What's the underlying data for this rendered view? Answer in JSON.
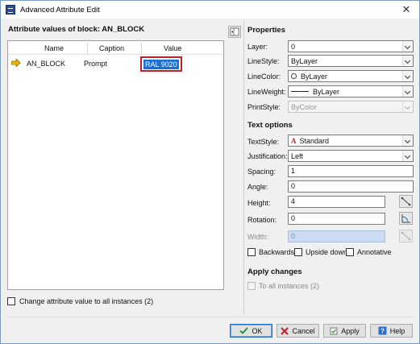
{
  "window": {
    "title": "Advanced Attribute Edit",
    "close_glyph": "✕"
  },
  "left": {
    "heading": "Attribute values of block: AN_BLOCK",
    "columns": [
      "Name",
      "Caption",
      "Value"
    ],
    "rows": [
      {
        "name": "AN_BLOCK",
        "caption": "Prompt",
        "value": "RAL 9020"
      }
    ],
    "change_all_label": "Change attribute value to all instances (2)"
  },
  "properties": {
    "title": "Properties",
    "layer": {
      "label": "Layer:",
      "value": "0"
    },
    "linestyle": {
      "label": "LineStyle:",
      "value": "ByLayer"
    },
    "linecolor": {
      "label": "LineColor:",
      "value": "ByLayer"
    },
    "lineweight": {
      "label": "LineWeight:",
      "value": "ByLayer"
    },
    "printstyle": {
      "label": "PrintStyle:",
      "value": "ByColor"
    }
  },
  "text_options": {
    "title": "Text options",
    "textstyle": {
      "label": "TextStyle:",
      "value": "Standard"
    },
    "justification": {
      "label": "Justification:",
      "value": "Left"
    },
    "spacing": {
      "label": "Spacing:",
      "value": "1"
    },
    "angle": {
      "label": "Angle:",
      "value": "0"
    },
    "height": {
      "label": "Height:",
      "value": "4"
    },
    "rotation": {
      "label": "Rotation:",
      "value": "0"
    },
    "width": {
      "label": "Width:",
      "value": "0"
    },
    "backwards_label": "Backwards",
    "upside_down_label": "Upside down",
    "annotative_label": "Annotative"
  },
  "apply_changes": {
    "title": "Apply changes",
    "all_instances_label": "To all instances (2)"
  },
  "buttons": {
    "ok": "OK",
    "cancel": "Cancel",
    "apply": "Apply",
    "help": "Help"
  },
  "icons": {
    "app": "block-attribute-icon",
    "row_marker": "arrow-right-icon",
    "pick_height": "pick-distance-icon",
    "pick_rotation": "pick-angle-icon",
    "pick_width": "pick-distance-icon"
  },
  "colors": {
    "accent": "#1a6fd6",
    "highlight_border": "#c0202a",
    "arrow": "#d9a400"
  }
}
